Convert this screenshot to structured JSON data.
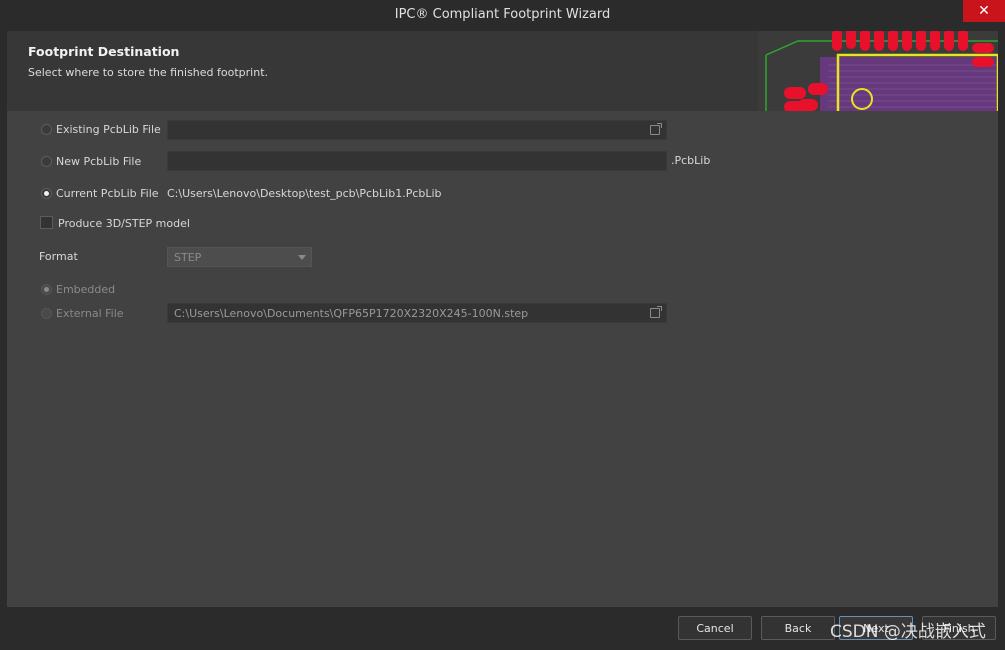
{
  "window": {
    "title": "IPC® Compliant Footprint Wizard",
    "close_glyph": "✕"
  },
  "header": {
    "title": "Footprint Destination",
    "subtitle": "Select where to store the finished footprint."
  },
  "destination": {
    "existing_label": "Existing PcbLib File",
    "existing_value": "",
    "new_label": "New PcbLib File",
    "new_value": "",
    "new_suffix": ".PcbLib",
    "current_label": "Current PcbLib File",
    "current_path": "C:\\Users\\Lenovo\\Desktop\\test_pcb\\PcbLib1.PcbLib",
    "selected": "current"
  },
  "model": {
    "produce_label": "Produce 3D/STEP model",
    "produce_checked": false,
    "format_label": "Format",
    "format_value": "STEP",
    "embedded_label": "Embedded",
    "external_label": "External File",
    "external_path": "C:\\Users\\Lenovo\\Documents\\QFP65P1720X2320X245-100N.step",
    "selected": "embedded"
  },
  "footer": {
    "cancel": "Cancel",
    "back": "Back",
    "next": "Next",
    "finish": "Finish"
  },
  "watermark": "CSDN @决战嵌入式",
  "icons": {
    "browse_1": "folder-browse-icon",
    "browse_2": "folder-browse-icon",
    "dropdown": "chevron-down-icon"
  },
  "colors": {
    "accent_red": "#c8141a",
    "pcb_pad": "#e8102a",
    "pcb_outline": "#e6e620",
    "pcb_board": "#2ea82e"
  }
}
